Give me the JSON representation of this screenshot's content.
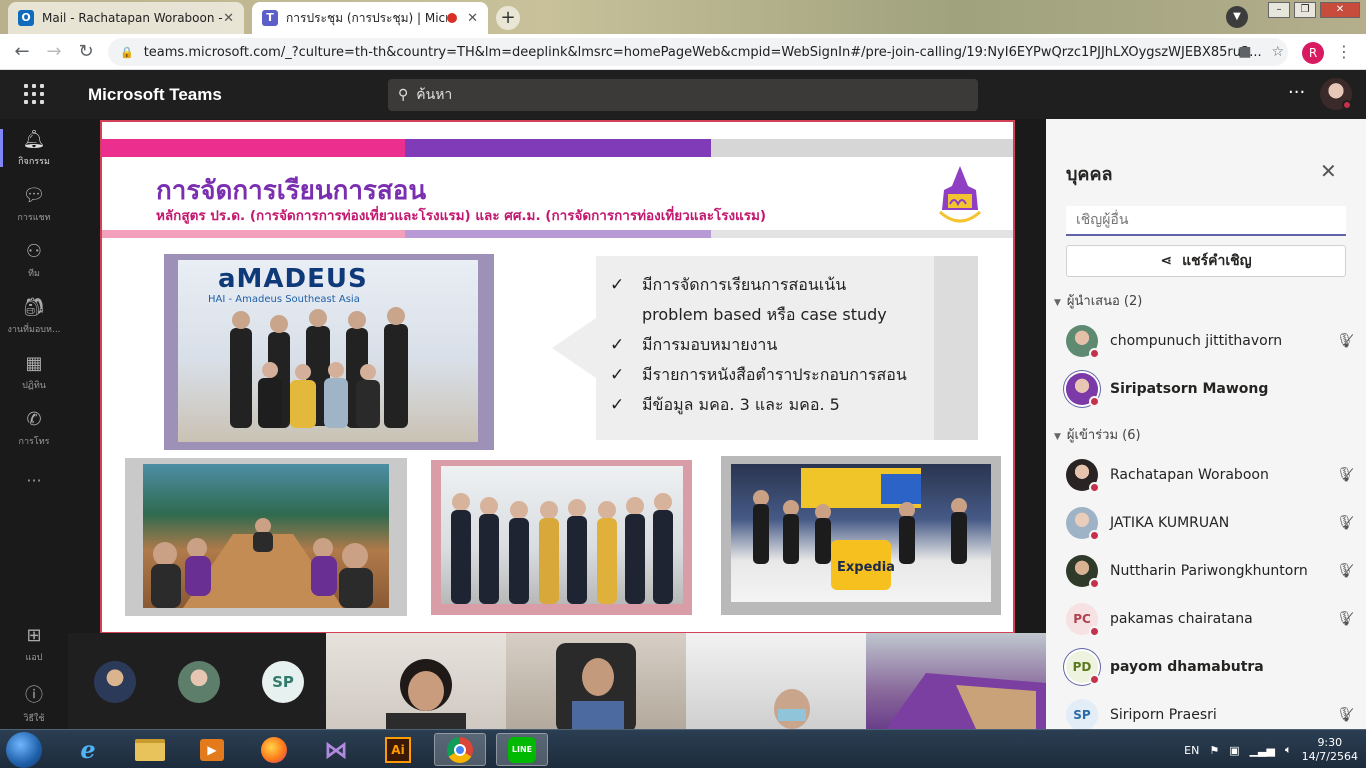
{
  "browser": {
    "tabs": [
      {
        "title": "Mail - Rachatapan Woraboon - O",
        "active": false
      },
      {
        "title": "การประชุม (การประชุม) | Micro",
        "active": true
      }
    ],
    "new_tab": "+",
    "url": "teams.microsoft.com/_?culture=th-th&country=TH&lm=deeplink&lmsrc=homePageWeb&cmpid=WebSignIn#/pre-join-calling/19:NyI6EYPwQrzc1PJJhLXOygszWJEBX85ru3...",
    "profile_initial": "R"
  },
  "teams": {
    "app_title": "Microsoft Teams",
    "search_placeholder": "ค้นหา",
    "more": "···"
  },
  "rail": {
    "items": [
      {
        "label": "กิจกรรม",
        "icon": "bell-icon"
      },
      {
        "label": "การแชท",
        "icon": "chat-icon"
      },
      {
        "label": "ทีม",
        "icon": "teams-icon"
      },
      {
        "label": "งานที่มอบห...",
        "icon": "assignments-icon"
      },
      {
        "label": "ปฏิทิน",
        "icon": "calendar-icon"
      },
      {
        "label": "การโทร",
        "icon": "phone-icon"
      },
      {
        "label": "···",
        "icon": "more-icon"
      },
      {
        "label": "แอป",
        "icon": "apps-icon"
      },
      {
        "label": "วิธีใช้",
        "icon": "help-icon"
      }
    ]
  },
  "slide": {
    "title": "การจัดการเรียนการสอน",
    "subtitle": "หลักสูตร ปร.ด. (การจัดการการท่องเที่ยวและโรงแรม) และ ศศ.ม. (การจัดการการท่องเที่ยวและโรงแรม)",
    "photo_sign": "aMADEUS",
    "photo_sign_sub": "HAI - Amadeus Southeast Asia",
    "expedia": "Expedia",
    "bullets": [
      {
        "check": "✓",
        "text": "มีการจัดการเรียนการสอนเน้น"
      },
      {
        "check": "",
        "text": "problem based หรือ case study"
      },
      {
        "check": "✓",
        "text": "มีการมอบหมายงาน"
      },
      {
        "check": "✓",
        "text": "มีรายการหนังสือตำราประกอบการสอน"
      },
      {
        "check": "✓",
        "text": "มีข้อมูล มคอ. 3 และ มคอ. 5"
      }
    ]
  },
  "panel": {
    "title": "บุคคล",
    "invite_placeholder": "เชิญผู้อื่น",
    "share_label": "แชร์คำเชิญ",
    "presenters_header": "ผู้นำเสนอ (2)",
    "attendees_header": "ผู้เข้าร่วม (6)",
    "presenters": [
      {
        "name": "chompunuch jittithavorn",
        "bold": false,
        "initials": "",
        "muted": true
      },
      {
        "name": "Siripatsorn Mawong",
        "bold": true,
        "initials": "",
        "muted": false
      }
    ],
    "attendees": [
      {
        "name": "Rachatapan Woraboon",
        "bold": false,
        "initials": "",
        "muted": true
      },
      {
        "name": "JATIKA KUMRUAN",
        "bold": false,
        "initials": "",
        "muted": true
      },
      {
        "name": "Nuttharin Pariwongkhuntorn",
        "bold": false,
        "initials": "",
        "muted": true
      },
      {
        "name": "pakamas chairatana",
        "bold": false,
        "initials": "PC",
        "muted": true
      },
      {
        "name": "payom dhamabutra",
        "bold": true,
        "initials": "PD",
        "muted": false
      },
      {
        "name": "Siriporn Praesri",
        "bold": false,
        "initials": "SP",
        "muted": true
      }
    ]
  },
  "video_strip": {
    "sp_initials": "SP"
  },
  "taskbar": {
    "lang": "EN",
    "time": "9:30",
    "date": "14/7/2564",
    "apps": [
      "ie",
      "explorer",
      "media",
      "firefox",
      "vs",
      "illustrator",
      "chrome",
      "line"
    ],
    "ai_label": "Ai",
    "line_label": "LINE"
  },
  "colors": {
    "teams_accent": "#6264a7",
    "status_red": "#c4314b",
    "slide_pink": "#ec2f8f",
    "slide_purple": "#7f3bb8"
  }
}
